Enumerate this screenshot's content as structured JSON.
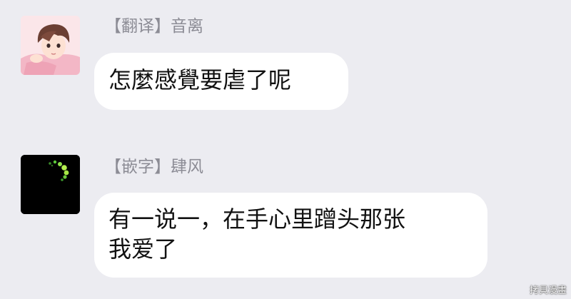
{
  "messages": [
    {
      "sender": "【翻译】音离",
      "avatar": "anime-boy-avatar",
      "text": "怎麼感覺要虐了呢"
    },
    {
      "sender": "【嵌字】肆风",
      "avatar": "fireflies-dark-avatar",
      "lines": [
        "有一说一，在手心里蹭头那张",
        "我爱了"
      ]
    }
  ],
  "watermark": "拷貝漫畫",
  "colors": {
    "background": "#ececf1",
    "bubble": "#ffffff",
    "sender_text": "#8c8c95",
    "message_text": "#111111"
  }
}
